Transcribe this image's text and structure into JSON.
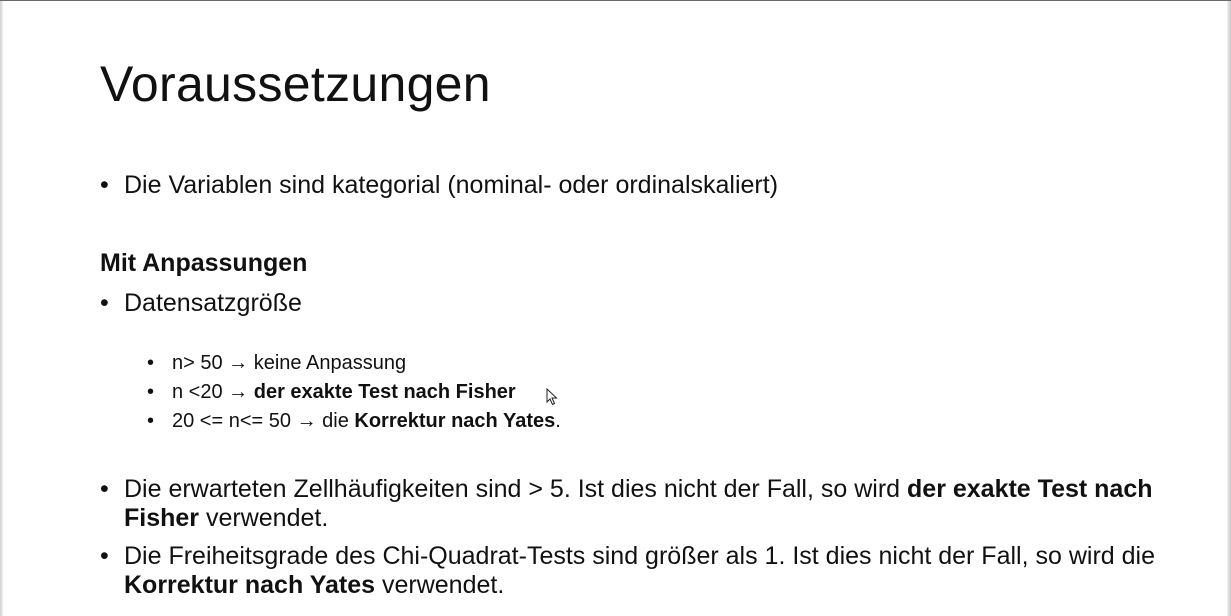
{
  "slide": {
    "title": "Voraussetzungen",
    "bullet_glyph": "•",
    "bullet_1": "Die Variablen sind kategorial (nominal- oder ordinalskaliert)",
    "section_heading": "Mit Anpassungen",
    "bullet_2": "Datensatzgröße",
    "sub_items": [
      {
        "condition": "n> 50",
        "arrow": "→",
        "result": " keine Anpassung"
      },
      {
        "condition": "n <20 ",
        "arrow": "→",
        "result_bold": "der exakte Test nach Fisher"
      },
      {
        "condition": "20 <= n<= 50",
        "arrow": "→",
        "prefix": "die ",
        "result_bold": "Korrektur nach Yates",
        "suffix": "."
      }
    ],
    "bullet_3": {
      "text_start": "Die erwarteten Zellhäufigkeiten sind > 5. Ist dies nicht der Fall, so wird ",
      "text_bold": "der exakte Test nach Fisher",
      "text_end": " verwendet."
    },
    "bullet_4": {
      "text_start": "Die Freiheitsgrade des Chi-Quadrat-Tests sind größer als 1. Ist dies nicht der Fall, so wird die ",
      "text_bold": "Korrektur nach Yates",
      "text_end": " verwendet."
    }
  }
}
